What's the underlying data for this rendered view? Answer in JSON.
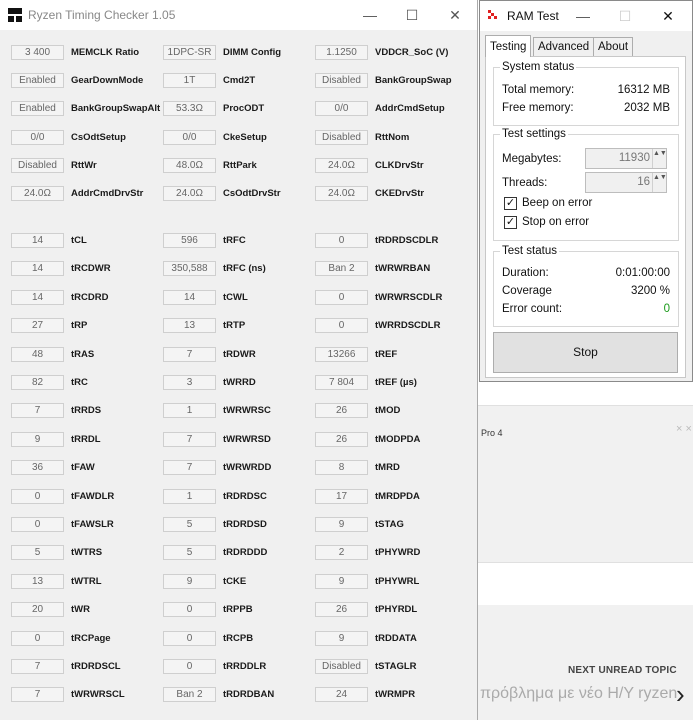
{
  "background": {
    "snippet_pro4": "Pro 4",
    "close_glyph": "× ×",
    "next_unread_label": "NEXT UNREAD TOPIC",
    "next_topic_title": "πρόβλημα με νέο Η/Υ ryzen",
    "chevron_glyph": "›"
  },
  "rtc": {
    "title": "Ryzen Timing Checker 1.05",
    "minimize_glyph": "—",
    "maximize_glyph": "☐",
    "close_glyph": "✕",
    "config_rows": [
      [
        [
          "3 400",
          "MEMCLK Ratio"
        ],
        [
          "1DPC-SR",
          "DIMM Config"
        ],
        [
          "1.1250",
          "VDDCR_SoC (V)"
        ]
      ],
      [
        [
          "Enabled",
          "GearDownMode"
        ],
        [
          "1T",
          "Cmd2T"
        ],
        [
          "Disabled",
          "BankGroupSwap"
        ]
      ],
      [
        [
          "Enabled",
          "BankGroupSwapAlt"
        ],
        [
          "53.3Ω",
          "ProcODT"
        ],
        [
          "0/0",
          "AddrCmdSetup"
        ]
      ],
      [
        [
          "0/0",
          "CsOdtSetup"
        ],
        [
          "0/0",
          "CkeSetup"
        ],
        [
          "Disabled",
          "RttNom"
        ]
      ],
      [
        [
          "Disabled",
          "RttWr"
        ],
        [
          "48.0Ω",
          "RttPark"
        ],
        [
          "24.0Ω",
          "CLKDrvStr"
        ]
      ],
      [
        [
          "24.0Ω",
          "AddrCmdDrvStr"
        ],
        [
          "24.0Ω",
          "CsOdtDrvStr"
        ],
        [
          "24.0Ω",
          "CKEDrvStr"
        ]
      ]
    ],
    "timing_rows": [
      [
        [
          "14",
          "tCL"
        ],
        [
          "596",
          "tRFC"
        ],
        [
          "0",
          "tRDRDSCDLR"
        ]
      ],
      [
        [
          "14",
          "tRCDWR"
        ],
        [
          "350,588",
          "tRFC (ns)"
        ],
        [
          "Ban 2",
          "tWRWRBAN"
        ]
      ],
      [
        [
          "14",
          "tRCDRD"
        ],
        [
          "14",
          "tCWL"
        ],
        [
          "0",
          "tWRWRSCDLR"
        ]
      ],
      [
        [
          "27",
          "tRP"
        ],
        [
          "13",
          "tRTP"
        ],
        [
          "0",
          "tWRRDSCDLR"
        ]
      ],
      [
        [
          "48",
          "tRAS"
        ],
        [
          "7",
          "tRDWR"
        ],
        [
          "13266",
          "tREF"
        ]
      ],
      [
        [
          "82",
          "tRC"
        ],
        [
          "3",
          "tWRRD"
        ],
        [
          "7 804",
          "tREF (µs)"
        ]
      ],
      [
        [
          "7",
          "tRRDS"
        ],
        [
          "1",
          "tWRWRSC"
        ],
        [
          "26",
          "tMOD"
        ]
      ],
      [
        [
          "9",
          "tRRDL"
        ],
        [
          "7",
          "tWRWRSD"
        ],
        [
          "26",
          "tMODPDA"
        ]
      ],
      [
        [
          "36",
          "tFAW"
        ],
        [
          "7",
          "tWRWRDD"
        ],
        [
          "8",
          "tMRD"
        ]
      ],
      [
        [
          "0",
          "tFAWDLR"
        ],
        [
          "1",
          "tRDRDSC"
        ],
        [
          "17",
          "tMRDPDA"
        ]
      ],
      [
        [
          "0",
          "tFAWSLR"
        ],
        [
          "5",
          "tRDRDSD"
        ],
        [
          "9",
          "tSTAG"
        ]
      ],
      [
        [
          "5",
          "tWTRS"
        ],
        [
          "5",
          "tRDRDDD"
        ],
        [
          "2",
          "tPHYWRD"
        ]
      ],
      [
        [
          "13",
          "tWTRL"
        ],
        [
          "9",
          "tCKE"
        ],
        [
          "9",
          "tPHYWRL"
        ]
      ],
      [
        [
          "20",
          "tWR"
        ],
        [
          "0",
          "tRPPB"
        ],
        [
          "26",
          "tPHYRDL"
        ]
      ],
      [
        [
          "0",
          "tRCPage"
        ],
        [
          "0",
          "tRCPB"
        ],
        [
          "9",
          "tRDDATA"
        ]
      ],
      [
        [
          "7",
          "tRDRDSCL"
        ],
        [
          "0",
          "tRRDDLR"
        ],
        [
          "Disabled",
          "tSTAGLR"
        ]
      ],
      [
        [
          "7",
          "tWRWRSCL"
        ],
        [
          "Ban 2",
          "tRDRDBAN"
        ],
        [
          "24",
          "tWRMPR"
        ]
      ]
    ]
  },
  "ramtest": {
    "title": "RAM Test",
    "minimize_glyph": "—",
    "maximize_glyph": "☐",
    "close_glyph": "✕",
    "tabs": [
      "Testing",
      "Advanced",
      "About"
    ],
    "system_status": {
      "title": "System status",
      "total_label": "Total memory:",
      "total_value": "16312 MB",
      "free_label": "Free memory:",
      "free_value": "2032 MB"
    },
    "test_settings": {
      "title": "Test settings",
      "megabytes_label": "Megabytes:",
      "megabytes_value": "11930",
      "threads_label": "Threads:",
      "threads_value": "16",
      "beep_label": "Beep on error",
      "beep_checked": true,
      "stop_label": "Stop on error",
      "stop_checked": true,
      "check_glyph": "✓",
      "spin_glyph": "▲▼"
    },
    "test_status": {
      "title": "Test status",
      "duration_label": "Duration:",
      "duration_value": "0:01:00:00",
      "coverage_label": "Coverage",
      "coverage_value": "3200 %",
      "errors_label": "Error count:",
      "errors_value": "0",
      "errors_color": "#1a9a1a"
    },
    "stop_button": "Stop"
  }
}
